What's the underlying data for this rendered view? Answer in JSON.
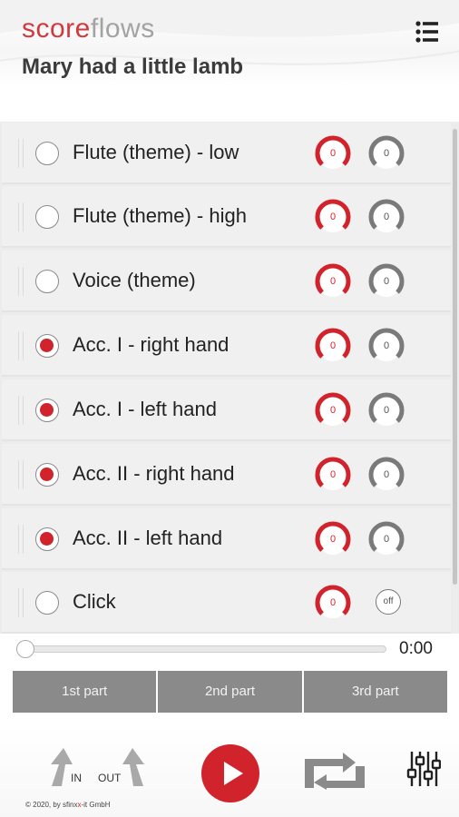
{
  "app": {
    "logo_part1": "score",
    "logo_part2": "flows",
    "title": "Mary had a little lamb"
  },
  "tracks": [
    {
      "label": "Flute (theme) - low",
      "selected": false,
      "volume": "0",
      "pan": "0"
    },
    {
      "label": "Flute (theme) - high",
      "selected": false,
      "volume": "0",
      "pan": "0"
    },
    {
      "label": "Voice (theme)",
      "selected": false,
      "volume": "0",
      "pan": "0"
    },
    {
      "label": "Acc. I - right hand",
      "selected": true,
      "volume": "0",
      "pan": "0"
    },
    {
      "label": "Acc. I - left hand",
      "selected": true,
      "volume": "0",
      "pan": "0"
    },
    {
      "label": "Acc. II - right hand",
      "selected": true,
      "volume": "0",
      "pan": "0"
    },
    {
      "label": "Acc. II - left hand",
      "selected": true,
      "volume": "0",
      "pan": "0"
    },
    {
      "label": "Click",
      "selected": false,
      "volume": "0",
      "pan": "off"
    }
  ],
  "player": {
    "time": "0:00",
    "progress": 0,
    "parts": [
      "1st part",
      "2nd part",
      "3rd part"
    ],
    "in_label": "IN",
    "out_label": "OUT"
  },
  "footer": {
    "copyright_prefix": "© 2020, by sfinx",
    "copyright_mid": "x",
    "copyright_suffix": "-it GmbH"
  },
  "colors": {
    "accent": "#d1232c",
    "logo_grey": "#a3a3a3",
    "button_grey": "#8a8a8a"
  },
  "icons": [
    "menu-icon",
    "in-arrow-icon",
    "out-arrow-icon",
    "play-icon",
    "loop-icon",
    "mixer-icon"
  ]
}
